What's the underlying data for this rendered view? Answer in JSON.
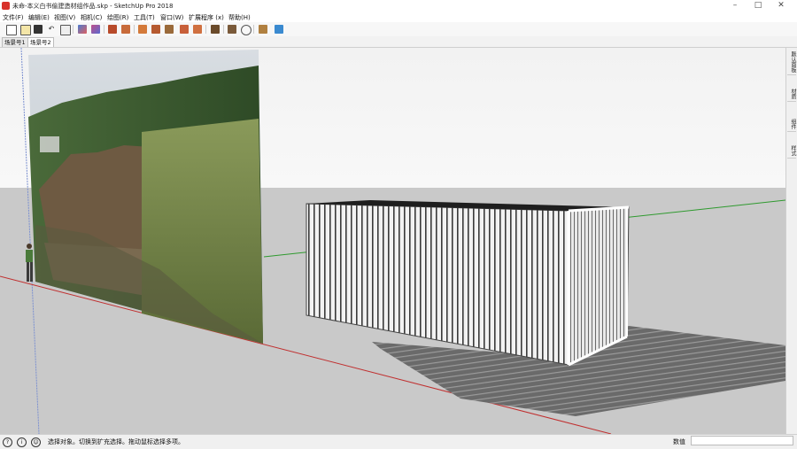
{
  "window": {
    "title": "未命-本义白书偷建造材组作品.skp - SketchUp Pro 2018",
    "minimize_glyph": "–",
    "maximize_glyph": "□",
    "close_glyph": "✕"
  },
  "menu": {
    "items": [
      {
        "label": "文件(F)"
      },
      {
        "label": "编辑(E)"
      },
      {
        "label": "视图(V)"
      },
      {
        "label": "相机(C)"
      },
      {
        "label": "绘图(R)"
      },
      {
        "label": "工具(T)"
      },
      {
        "label": "窗口(W)"
      },
      {
        "label": "扩展程序 (x)"
      },
      {
        "label": "帮助(H)"
      }
    ]
  },
  "toolbar": {
    "icons": [
      "new-icon",
      "open-icon",
      "save-icon",
      "undo-icon",
      "print-icon",
      "select-icon",
      "eraser-icon",
      "paint-icon",
      "line-icon",
      "pencil-icon",
      "arc-icon",
      "shape-icon",
      "push-pull-icon",
      "move-icon",
      "rotate-icon",
      "scale-icon",
      "tape-icon",
      "component-icon",
      "orbit-icon",
      "pan-icon",
      "warehouse-icon",
      "extension-icon"
    ]
  },
  "scene_tabs": [
    {
      "label": "场景号1"
    },
    {
      "label": "场景号2"
    }
  ],
  "tray": {
    "tabs": [
      {
        "label": "默认面板"
      },
      {
        "label": "材质"
      },
      {
        "label": "组件"
      },
      {
        "label": "样式"
      }
    ]
  },
  "statusbar": {
    "hint": "选择对象。切换到扩充选择。拖动鼠标选择多项。",
    "measurements_label": "数值",
    "measurements_value": "",
    "icon1": "?",
    "icon2": "i",
    "icon3": "☺"
  },
  "colors": {
    "sky": "#f4f4f4",
    "ground": "#c9c9c9",
    "accent": "#d8322b",
    "red_axis": "#c03030",
    "green_axis": "#2f9a2f",
    "blue_axis": "#7a8fd0"
  }
}
